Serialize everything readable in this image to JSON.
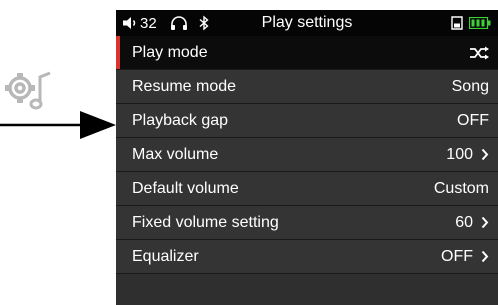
{
  "status_bar": {
    "volume_level": "32",
    "title": "Play settings",
    "icons": [
      "speaker-icon",
      "headphones-icon",
      "bluetooth-icon",
      "sd-card-icon",
      "battery-icon"
    ],
    "battery_color": "#3fd13a"
  },
  "menu": {
    "items": [
      {
        "label": "Play mode",
        "value": "",
        "icon": "shuffle-icon"
      },
      {
        "label": "Resume mode",
        "value": "Song"
      },
      {
        "label": "Playback gap",
        "value": "OFF"
      },
      {
        "label": "Max volume",
        "value": "100"
      },
      {
        "label": "Default volume",
        "value": "Custom"
      },
      {
        "label": "Fixed volume setting",
        "value": "60"
      },
      {
        "label": "Equalizer",
        "value": "OFF"
      }
    ],
    "selected_index": 0,
    "accent_color": "#d9342b"
  },
  "annotation": {
    "icon": "music-settings-icon",
    "pointer": "arrow-right-icon"
  }
}
